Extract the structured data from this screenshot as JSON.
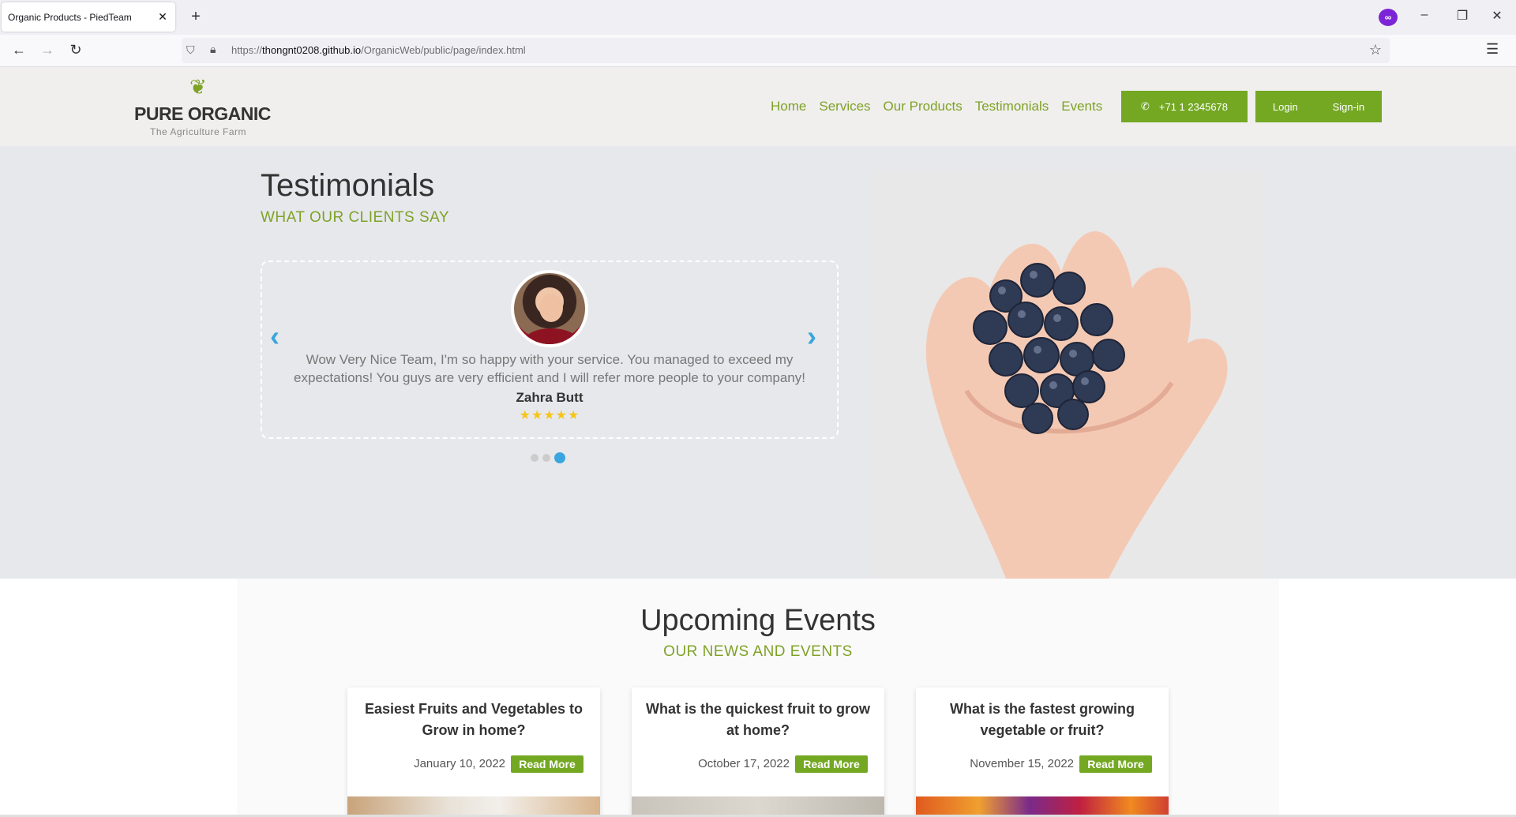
{
  "browser": {
    "tab_title": "Organic Products - PiedTeam",
    "tab_close": "✕",
    "new_tab": "+",
    "url_prefix": "https://",
    "url_domain": "thongnt0208.github.io",
    "url_path": "/OrganicWeb/public/page/index.html"
  },
  "site": {
    "logo_name": "PURE ORGANIC",
    "logo_tagline": "The Agriculture Farm",
    "nav": [
      "Home",
      "Services",
      "Our Products",
      "Testimonials",
      "Events"
    ],
    "phone": "+71 1 2345678",
    "login": "Login",
    "signin": "Sign-in"
  },
  "testimonials": {
    "title": "Testimonials",
    "subtitle": "WHAT OUR CLIENTS SAY",
    "quote": "Wow Very Nice Team, I'm so happy with your service. You managed to exceed my expectations! You guys are very efficient and I will refer more people to your company!",
    "name": "Zahra Butt",
    "rating": 5,
    "stars": "★★★★★",
    "slide_count": 3,
    "active_slide": 3
  },
  "events": {
    "title": "Upcoming Events",
    "subtitle": "OUR NEWS AND EVENTS",
    "items": [
      {
        "title": "Easiest Fruits and Vegetables to Grow in home?",
        "date": "January 10, 2022",
        "cta": "Read More"
      },
      {
        "title": "What is the quickest fruit to grow at home?",
        "date": "October 17, 2022",
        "cta": "Read More"
      },
      {
        "title": "What is the fastest growing vegetable or fruit?",
        "date": "November 15, 2022",
        "cta": "Read More"
      }
    ]
  },
  "colors": {
    "brand_green": "#74a823",
    "accent_blue": "#3aa6dd",
    "star_gold": "#f5c518"
  }
}
